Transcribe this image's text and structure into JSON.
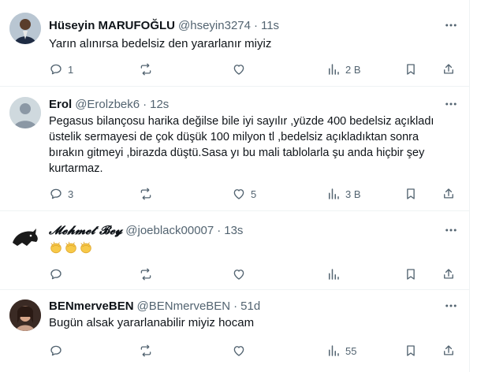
{
  "colors": {
    "text": "#0f1419",
    "muted": "#536471",
    "divider": "#eff3f4"
  },
  "tweets": [
    {
      "name": "Hüseyin MARUFOĞLU",
      "handle": "@hseyin3274",
      "dot": "·",
      "time": "11s",
      "text": "Yarın alınırsa bedelsiz den yararlanır miyiz",
      "replies": "1",
      "retweets": "",
      "likes": "",
      "views": "2 B"
    },
    {
      "name": "Erol",
      "handle": "@Erolzbek6",
      "dot": "·",
      "time": "12s",
      "text": "Pegasus bilançosu harika değilse bile iyi sayılır ,yüzde 400 bedelsiz açıkladı üstelik sermayesi de çok düşük 100 milyon tl ,bedelsiz açıkladıktan sonra bırakın gitmeyi ,birazda düştü.Sasa yı bu mali tablolarla şu anda hiçbir şey kurtarmaz.",
      "replies": "3",
      "retweets": "",
      "likes": "5",
      "views": "3 B"
    },
    {
      "name": "𝓜𝓮𝓱𝓶𝓮𝓽 𝓑𝓮𝔂",
      "handle": "@joeblack00007",
      "dot": "·",
      "time": "13s",
      "text": "",
      "emoji_icons": [
        "clapping-hands",
        "clapping-hands",
        "clapping-hands"
      ],
      "replies": "",
      "retweets": "",
      "likes": "",
      "views": ""
    },
    {
      "name": "BENmerveBEN",
      "handle": "@BENmerveBEN",
      "dot": "·",
      "time": "51d",
      "text": "Bugün alsak yararlanabilir miyiz hocam",
      "replies": "",
      "retweets": "",
      "likes": "",
      "views": "55"
    }
  ]
}
